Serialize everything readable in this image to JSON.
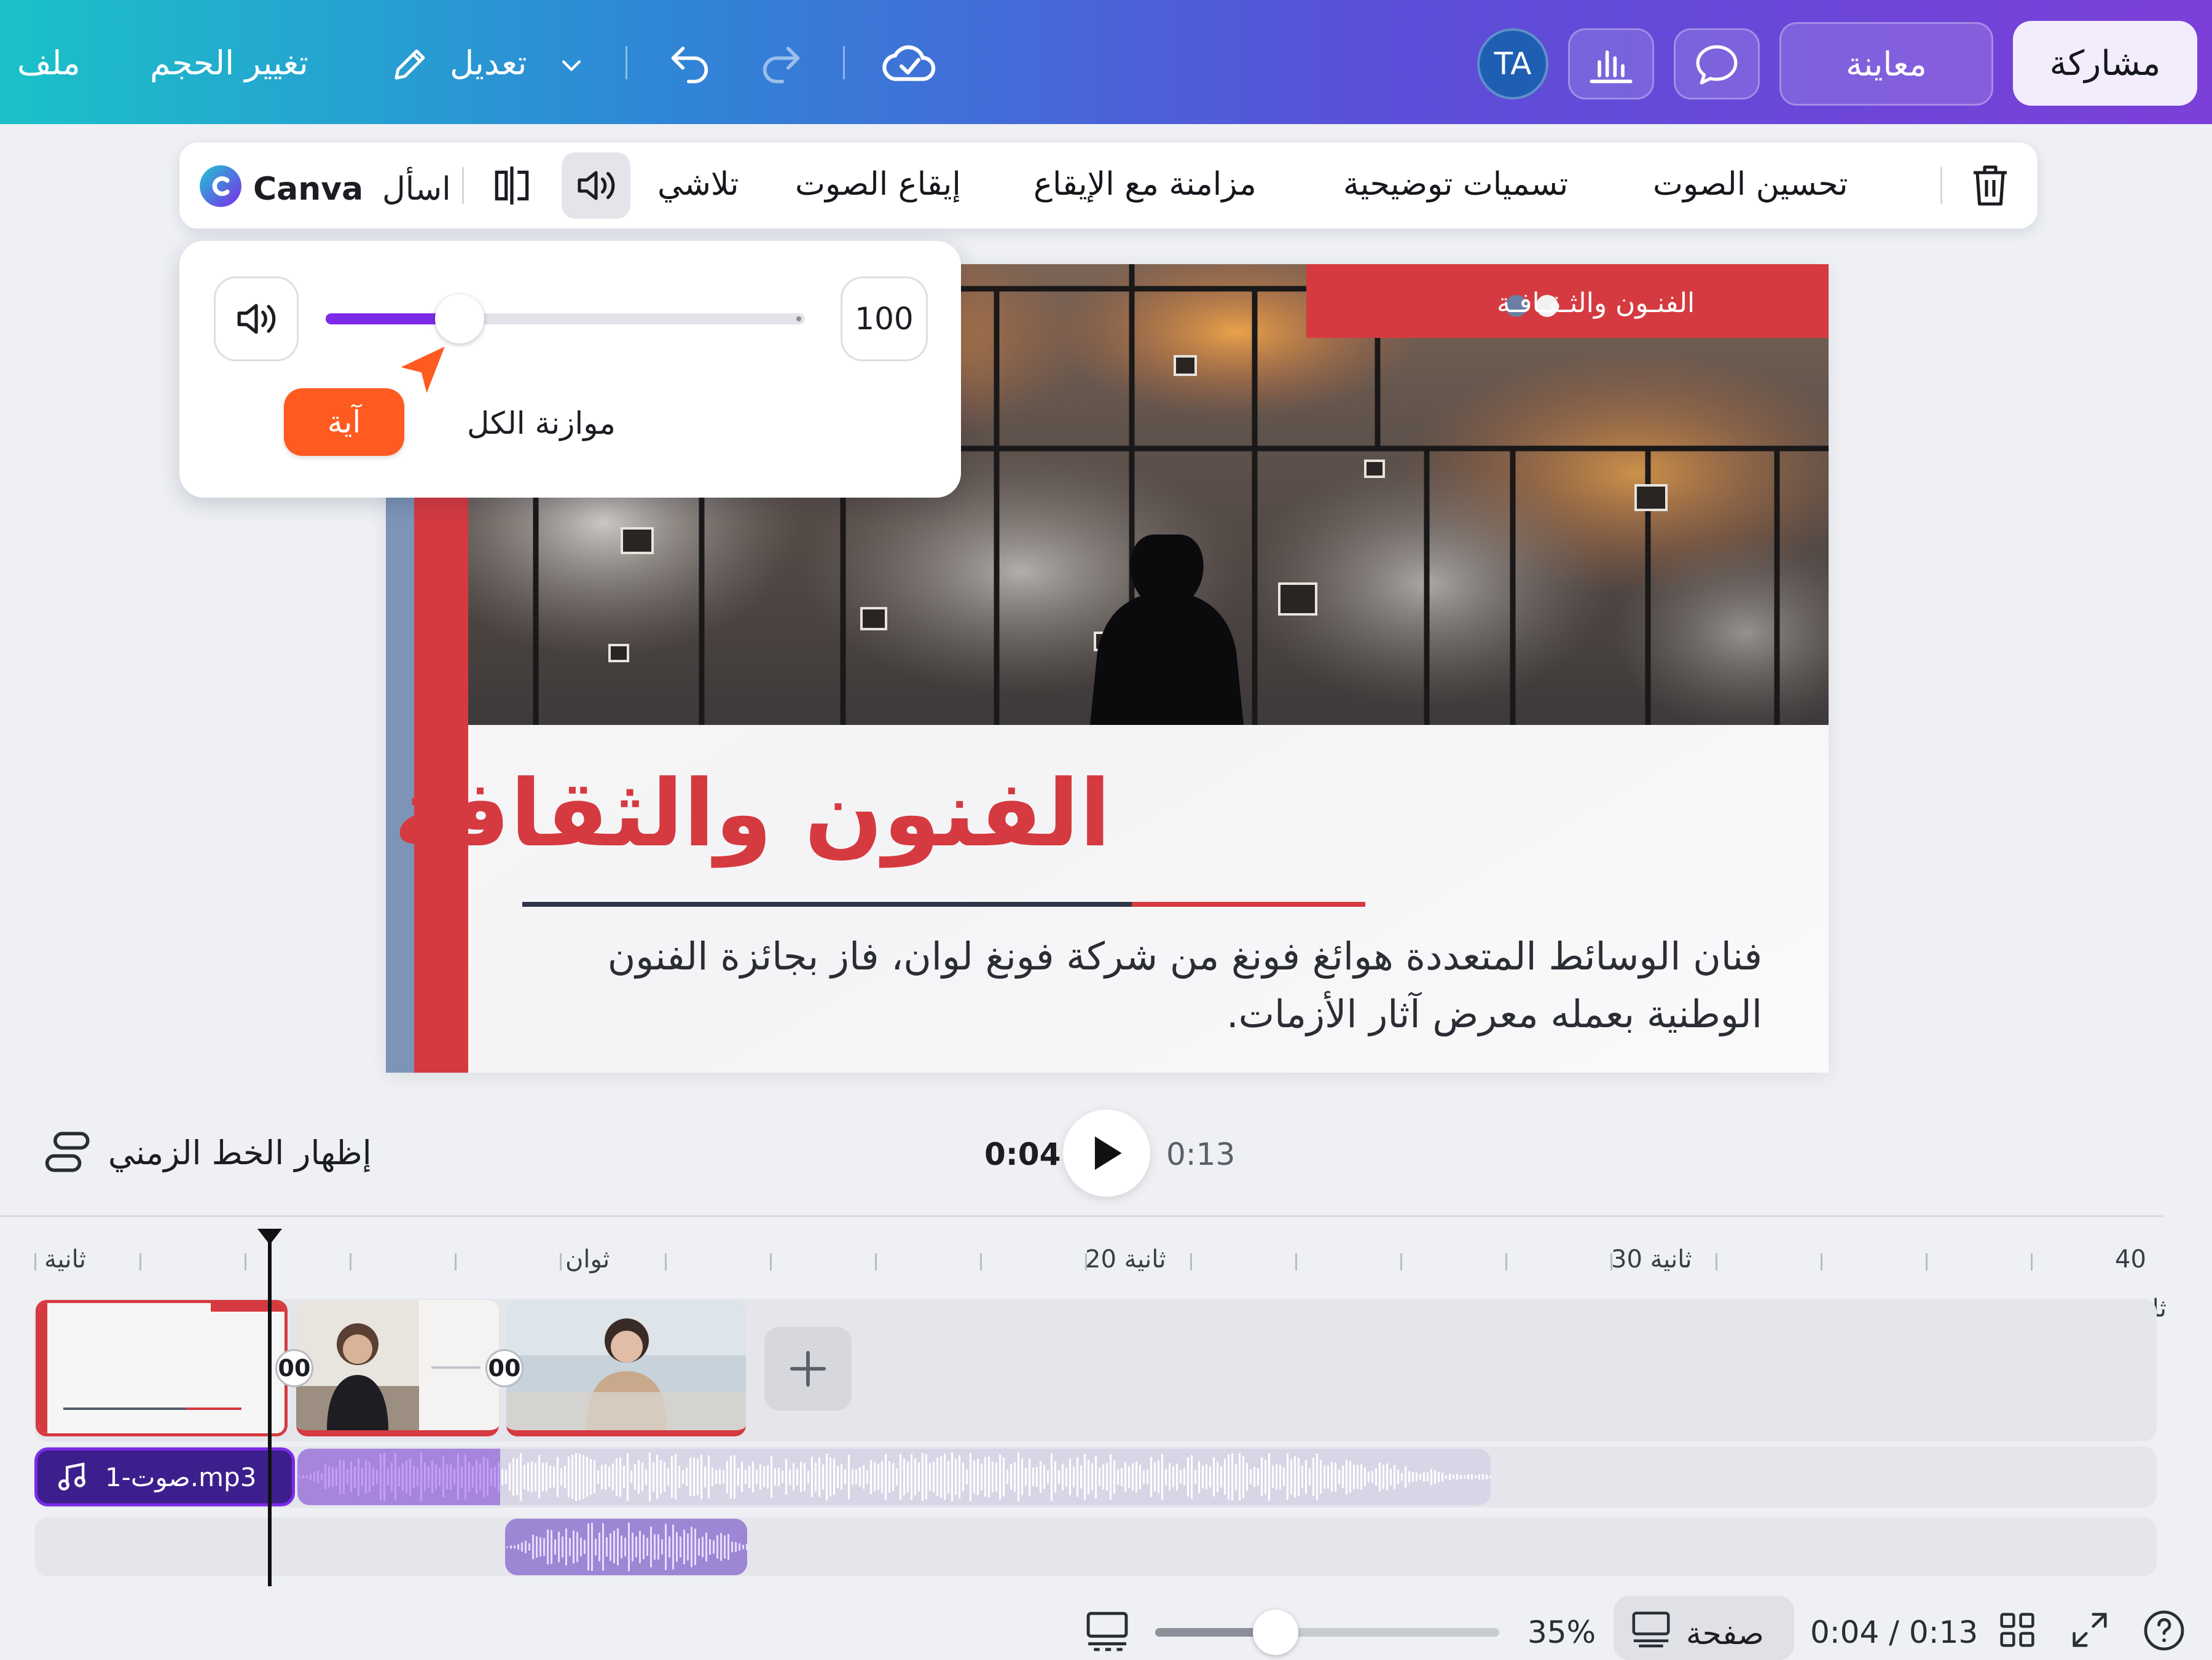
{
  "header": {
    "file_menu": "ملف",
    "resize_menu": "تغيير الحجم",
    "edit_menu": "تعديل",
    "avatar_initials": "TA",
    "preview_button": "معاينة",
    "share_button": "مشاركة",
    "icons": [
      "pencil-icon",
      "chevron-down-icon",
      "undo-icon",
      "redo-icon",
      "cloud-check-icon",
      "analytics-icon",
      "comment-icon"
    ]
  },
  "audio_toolbar": {
    "ask_canva": "اسأل",
    "canva_brand": "Canva",
    "fade": "تلاشي",
    "audio_rhythm": "إيقاع الصوت",
    "beat_sync": "مزامنة مع الإيقاع",
    "captions": "تسميات توضيحية",
    "enhance_audio": "تحسين الصوت",
    "icons": [
      "canva-logo-icon",
      "split-icon",
      "volume-icon",
      "trash-icon"
    ]
  },
  "volume_popover": {
    "value": "100",
    "level_fraction": 0.28,
    "balance_all_label": "موازنة الكل",
    "tooltip_name": "آية",
    "accent_color": "#7d2ae8",
    "cursor_color": "#ff5a1f"
  },
  "slide": {
    "badge_text": "الفنـون والثـقـافـة",
    "title": "الفنون والثقافة",
    "body": "فنان الوسائط المتعددة هوائغ فونغ من شركة فونغ لوان، فاز بجائزة الفنون الوطنية بعمله معرض آثار الأزمات.",
    "accent_color": "#d53a40"
  },
  "playback": {
    "show_timeline": "إظهار الخط الزمني",
    "current_time": "0:04",
    "total_time": "0:13"
  },
  "timeline": {
    "ruler_labels": [
      "ثانية",
      "ثوان",
      "20 ثانية",
      "30 ثانية",
      "40"
    ],
    "end_unit_label": "ثانية",
    "transition_labels": [
      "00",
      "00"
    ],
    "audio_track_name": "صوت-1.mp3",
    "add_clip_icon": "plus-icon"
  },
  "bottom_bar": {
    "zoom_percent": "35%",
    "zoom_level_fraction": 0.35,
    "page_view": "صفحة",
    "time_display": "0:04 / 0:13",
    "icons": [
      "notes-icon",
      "page-view-icon",
      "grid-view-icon",
      "fullscreen-icon",
      "help-icon"
    ]
  }
}
